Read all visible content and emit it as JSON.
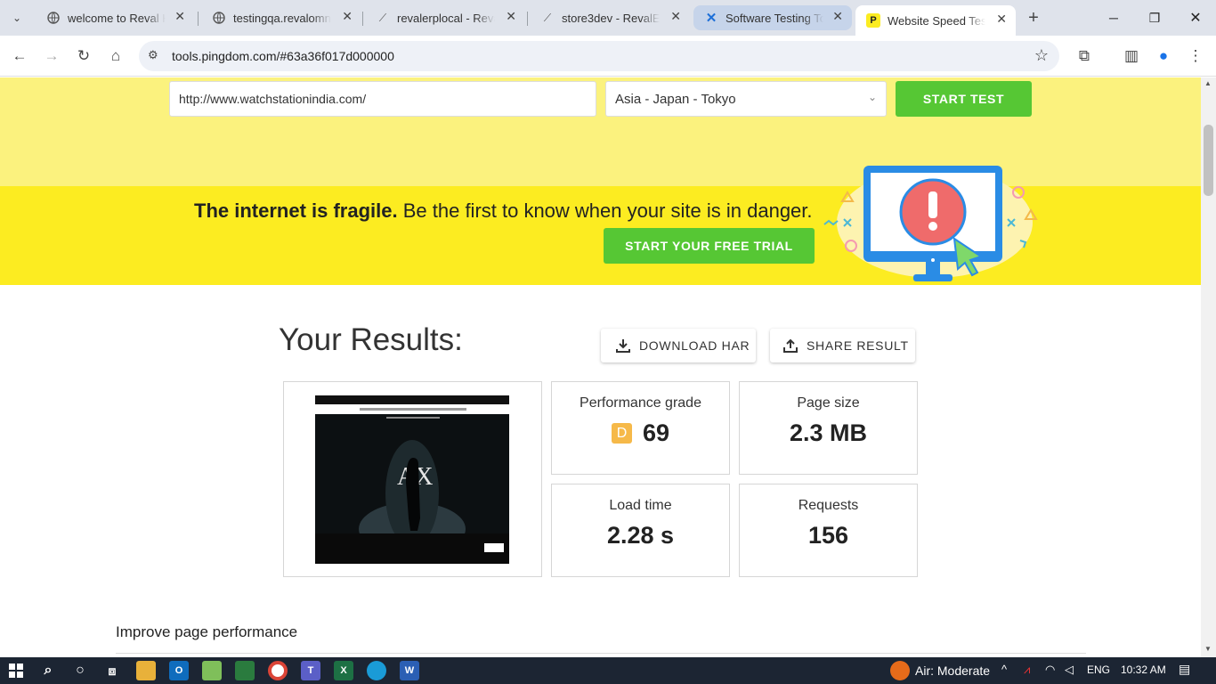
{
  "browser": {
    "tabs": [
      {
        "title": "welcome to Reval HRM",
        "icon": "globe-icon"
      },
      {
        "title": "testingqa.revalomni.com",
        "icon": "globe-icon"
      },
      {
        "title": "revalerplocal - RevalERP",
        "icon": "feather-icon"
      },
      {
        "title": "store3dev - RevalERP",
        "icon": "feather-icon"
      },
      {
        "title": "Software Testing Tools",
        "icon": "x-logo-icon"
      },
      {
        "title": "Website Speed Test | Pingdom",
        "icon": "pingdom-icon"
      }
    ],
    "address": "tools.pingdom.com/#63a36f017d000000"
  },
  "test_form": {
    "url_value": "http://www.watchstationindia.com/",
    "location_value": "Asia - Japan - Tokyo",
    "start_label": "START TEST"
  },
  "banner": {
    "headline_bold": "The internet is fragile.",
    "headline_rest": " Be the first to know when your site is in danger.",
    "trial_label": "START YOUR FREE TRIAL"
  },
  "results": {
    "title": "Your Results:",
    "download_label": "DOWNLOAD HAR",
    "share_label": "SHARE RESULT",
    "metrics": {
      "grade_label": "Performance grade",
      "grade_letter": "D",
      "grade_value": "69",
      "size_label": "Page size",
      "size_value": "2.3 MB",
      "load_label": "Load time",
      "load_value": "2.28 s",
      "requests_label": "Requests",
      "requests_value": "156"
    },
    "improve_title": "Improve page performance"
  },
  "taskbar": {
    "weather": "Air: Moderate",
    "lang": "ENG",
    "time": "10:32 AM"
  },
  "colors": {
    "accent_green": "#56c734",
    "banner_yellow": "#fcec21",
    "grade_orange": "#f6b949"
  }
}
